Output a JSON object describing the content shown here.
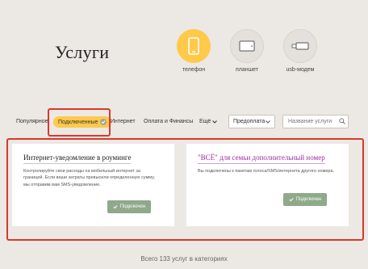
{
  "header": {
    "title": "Услуги"
  },
  "devices": [
    {
      "label": "телефон",
      "icon": "phone-icon",
      "active": true
    },
    {
      "label": "планшет",
      "icon": "tablet-icon",
      "active": false
    },
    {
      "label": "usb-модем",
      "icon": "usb-modem-icon",
      "active": false
    }
  ],
  "tabs": {
    "popular": "Популярное",
    "connected": "Подключенные",
    "internet": "Интернет",
    "finance": "Оплата и Финансы",
    "more": "Ещё"
  },
  "filter": {
    "payment_type": "Предоплата"
  },
  "search": {
    "placeholder": "Название услуги"
  },
  "cards": [
    {
      "title": "Интернет-уведомление в роуминге",
      "description": "Контролируйте свои расходы на мобильный интернет за границей. Если ваши затраты превысили определенную сумму, мы отправим вам SMS-уведомление.",
      "button": "Подключен"
    },
    {
      "title": "\"ВСЁ\" для семьи дополнительный номер",
      "description": "Вы подключены к пакетам голоса/SMS/интернета другого номера.",
      "button": "Подключен"
    }
  ],
  "footer": {
    "text": "Всего 133 услуг в категориях"
  },
  "colors": {
    "accent": "#ffc94a",
    "highlight": "#d9382c",
    "button": "#8fa98a",
    "link": "#9b2fa0"
  }
}
